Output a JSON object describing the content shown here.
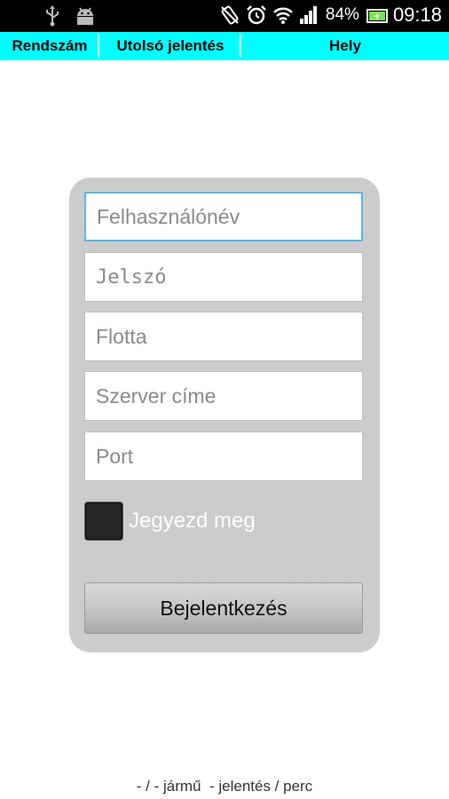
{
  "status_bar": {
    "battery": "84%",
    "time": "09:18",
    "icons": [
      "usb-icon",
      "android-debug-icon",
      "no-rotate-icon",
      "alarm-icon",
      "wifi-icon",
      "signal-icon",
      "battery-icon"
    ]
  },
  "header": {
    "columns": [
      "Rendszám",
      "Utolsó jelentés",
      "Hely"
    ],
    "background": "#00ffff"
  },
  "login": {
    "username_placeholder": "Felhasználónév",
    "password_placeholder": "Jelszó",
    "fleet_placeholder": "Flotta",
    "server_placeholder": "Szerver címe",
    "port_placeholder": "Port",
    "remember_label": "Jegyezd meg",
    "login_button": "Bejelentkezés"
  },
  "footer": {
    "stats": "- / - jármű  - jelentés / perc"
  }
}
